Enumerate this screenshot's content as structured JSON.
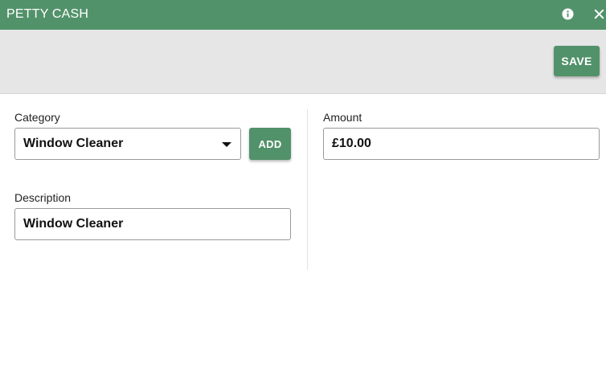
{
  "window": {
    "title": "PETTY CASH",
    "info_icon": "info-icon",
    "close_icon": "close-icon",
    "accent_color": "#52926a"
  },
  "toolbar": {
    "save_label": "SAVE"
  },
  "form": {
    "category": {
      "label": "Category",
      "selected": "Window Cleaner",
      "add_label": "ADD"
    },
    "amount": {
      "label": "Amount",
      "value": "£10.00"
    },
    "description": {
      "label": "Description",
      "value": "Window Cleaner"
    }
  }
}
